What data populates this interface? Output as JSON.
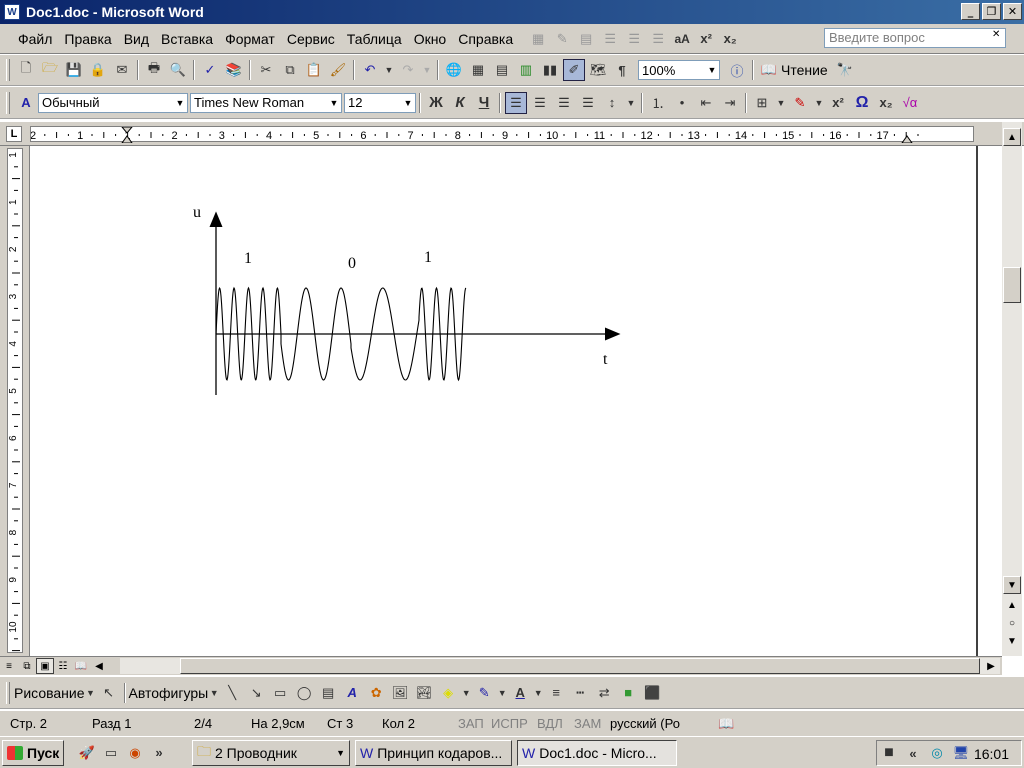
{
  "window": {
    "title": "Doc1.doc - Microsoft Word",
    "app_icon": "word-doc-icon"
  },
  "menu": [
    "Файл",
    "Правка",
    "Вид",
    "Вставка",
    "Формат",
    "Сервис",
    "Таблица",
    "Окно",
    "Справка"
  ],
  "help": {
    "placeholder": "Введите вопрос"
  },
  "standard_toolbar": {
    "zoom": "100%",
    "reading_label": "Чтение"
  },
  "formatting_toolbar": {
    "style": "Обычный",
    "font": "Times New Roman",
    "size": "12",
    "bold": "Ж",
    "italic": "К",
    "underline": "Ч"
  },
  "ruler": {
    "corner": "L",
    "h_marks": [
      "2",
      "1",
      "1",
      "2",
      "3",
      "4",
      "5",
      "6",
      "7",
      "8",
      "9",
      "10",
      "11",
      "12",
      "13",
      "14",
      "15",
      "16",
      "17"
    ],
    "v_marks": [
      "1",
      "1",
      "2",
      "3",
      "4",
      "5",
      "6",
      "7",
      "8",
      "9",
      "10",
      "11"
    ]
  },
  "figure": {
    "y_axis_label": "u",
    "x_axis_label": "t",
    "bit_labels": [
      "1",
      "0",
      "1"
    ]
  },
  "drawing_toolbar": {
    "draw_label": "Рисование",
    "autoshapes_label": "Автофигуры"
  },
  "status": {
    "page": "Стр. 2",
    "section": "Разд 1",
    "pages": "2/4",
    "at": "На 2,9см",
    "line": "Ст 3",
    "col": "Кол 2",
    "rec": "ЗАП",
    "trk": "ИСПР",
    "ext": "ВДЛ",
    "ovr": "ЗАМ",
    "lang": "русский (Ро"
  },
  "taskbar": {
    "start": "Пуск",
    "buttons": [
      "2 Проводник",
      "Принцип кодаров...",
      "Doc1.doc - Micro..."
    ],
    "clock": "16:01"
  }
}
